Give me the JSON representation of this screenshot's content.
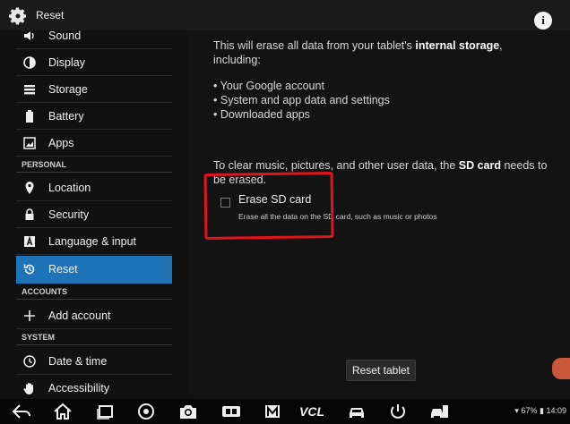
{
  "titlebar": {
    "title": "Reset",
    "icon": "gear-icon",
    "info_label": "i"
  },
  "sidebar": {
    "items_top": [
      {
        "label": "Sound",
        "icon": "sound-icon"
      },
      {
        "label": "Display",
        "icon": "display-icon"
      },
      {
        "label": "Storage",
        "icon": "storage-icon"
      },
      {
        "label": "Battery",
        "icon": "battery-icon"
      },
      {
        "label": "Apps",
        "icon": "apps-icon"
      }
    ],
    "section_personal": "PERSONAL",
    "items_personal": [
      {
        "label": "Location",
        "icon": "location-icon"
      },
      {
        "label": "Security",
        "icon": "lock-icon"
      },
      {
        "label": "Language & input",
        "icon": "language-icon"
      },
      {
        "label": "Reset",
        "icon": "reset-icon",
        "selected": true
      }
    ],
    "section_accounts": "ACCOUNTS",
    "items_accounts": [
      {
        "label": "Add account",
        "icon": "plus-icon"
      }
    ],
    "section_system": "SYSTEM",
    "items_system": [
      {
        "label": "Date & time",
        "icon": "clock-icon"
      },
      {
        "label": "Accessibility",
        "icon": "hand-icon"
      }
    ]
  },
  "main": {
    "intro_prefix": "This will erase all data from your tablet's ",
    "intro_bold": "internal storage",
    "intro_suffix": ", including:",
    "bullets": [
      "Your Google account",
      "System and app data and settings",
      "Downloaded apps"
    ],
    "sd_prefix": "To clear music, pictures, and other user data, the ",
    "sd_bold": "SD card",
    "sd_suffix": " needs to be erased.",
    "erase_sd": {
      "title": "Erase SD card",
      "subtitle": "Erase all the data on the SD card, such as music or photos",
      "checked": false
    },
    "reset_button": "Reset tablet",
    "highlight_color": "#e0141b"
  },
  "navbar": {
    "icons": [
      "back-icon",
      "home-icon",
      "recent-apps-icon",
      "chrome-icon",
      "camera-icon",
      "vci-icon",
      "m-icon",
      "vcl-icon",
      "car-icon",
      "power-icon",
      "car-diag-icon"
    ],
    "vcl_label": "VCL",
    "battery_percent": "67%",
    "time": "14:09"
  },
  "colors": {
    "accent": "#1f73b7",
    "background": "#131313"
  }
}
